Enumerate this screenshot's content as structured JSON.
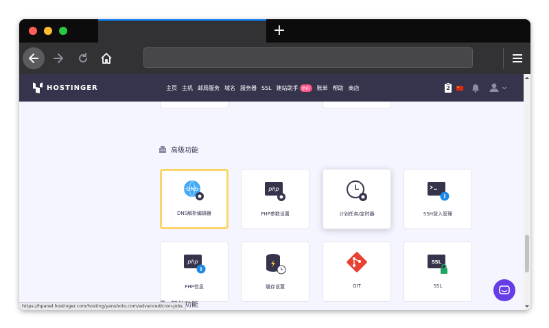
{
  "browser": {
    "new_tab_symbol": "+",
    "url": ""
  },
  "header": {
    "logo_text": "HOSTINGER",
    "nav_items": [
      "主页",
      "主机",
      "邮局服务",
      "域名",
      "服务器",
      "SSL",
      "建站助手"
    ],
    "builder_badge": "新的",
    "nav_items_after": [
      "账单",
      "帮助",
      "商店"
    ],
    "notification_count": "2"
  },
  "section_advanced": {
    "title": "高级功能",
    "cards": [
      {
        "label": "DNS解析编辑器",
        "icon": "dns-settings-icon"
      },
      {
        "label": "PHP参数设置",
        "icon": "php-settings-icon"
      },
      {
        "label": "计划任务/定时器",
        "icon": "cron-jobs-icon"
      },
      {
        "label": "SSH登入管理",
        "icon": "ssh-icon"
      },
      {
        "label": "PHP信息",
        "icon": "php-info-icon"
      },
      {
        "label": "缓存设置",
        "icon": "cache-icon"
      },
      {
        "label": "GIT",
        "icon": "git-icon"
      },
      {
        "label": "SSL",
        "icon": "ssl-icon"
      }
    ]
  },
  "section_other": {
    "title": "其他功能"
  },
  "status_url": "https://hpanel.hostinger.com/hosting/yanshoto.com/advanced/cron-jobs",
  "colors": {
    "header_bg": "#36344d",
    "accent": "#673de6",
    "badge": "#fc5185",
    "active_border": "#fcd56a"
  }
}
